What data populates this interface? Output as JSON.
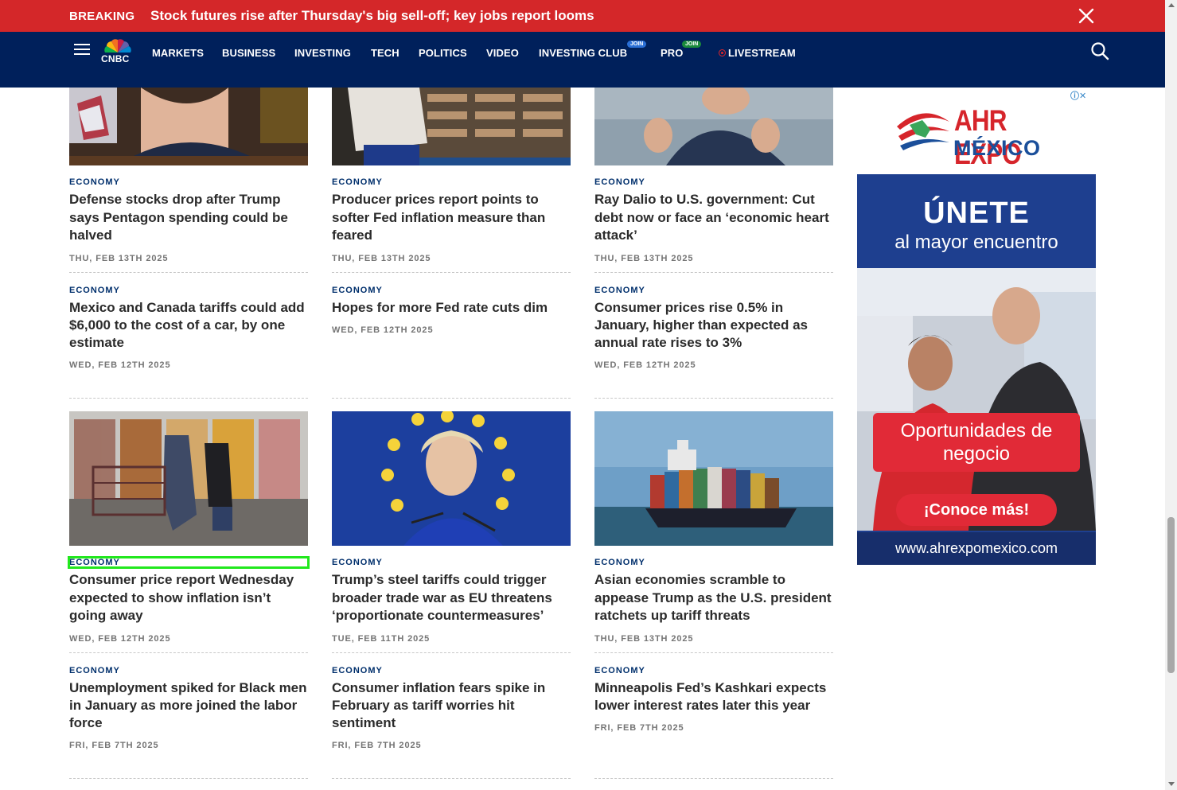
{
  "breaking": {
    "tag": "BREAKING",
    "headline": "Stock futures rise after Thursday's big sell-off; key jobs report looms"
  },
  "nav": {
    "logo_text": "CNBC",
    "links": [
      "MARKETS",
      "BUSINESS",
      "INVESTING",
      "TECH",
      "POLITICS",
      "VIDEO",
      "INVESTING CLUB",
      "PRO",
      "LIVESTREAM"
    ],
    "join_label": "JOIN"
  },
  "articles": [
    {
      "kicker": "ECONOMY",
      "title": "Defense stocks drop after Trump says Pentagon spending could be halved",
      "date": "THU, FEB 13TH 2025"
    },
    {
      "kicker": "ECONOMY",
      "title": "Producer prices report points to softer Fed inflation measure than feared",
      "date": "THU, FEB 13TH 2025"
    },
    {
      "kicker": "ECONOMY",
      "title": "Ray Dalio to U.S. government: Cut debt now or face an ‘economic heart attack’",
      "date": "THU, FEB 13TH 2025"
    },
    {
      "kicker": "ECONOMY",
      "title": "Mexico and Canada tariffs could add $6,000 to the cost of a car, by one estimate",
      "date": "WED, FEB 12TH 2025"
    },
    {
      "kicker": "ECONOMY",
      "title": "Hopes for more Fed rate cuts dim",
      "date": "WED, FEB 12TH 2025"
    },
    {
      "kicker": "ECONOMY",
      "title": "Consumer prices rise 0.5% in January, higher than expected as annual rate rises to 3%",
      "date": "WED, FEB 12TH 2025"
    },
    {
      "kicker": "ECONOMY",
      "title": "Consumer price report Wednesday expected to show inflation isn’t going away",
      "date": "WED, FEB 12TH 2025"
    },
    {
      "kicker": "ECONOMY",
      "title": "Trump’s steel tariffs could trigger broader trade war as EU threatens ‘proportionate countermeasures’",
      "date": "TUE, FEB 11TH 2025"
    },
    {
      "kicker": "ECONOMY",
      "title": "Asian economies scramble to appease Trump as the U.S. president ratchets up tariff threats",
      "date": "THU, FEB 13TH 2025"
    },
    {
      "kicker": "ECONOMY",
      "title": "Unemployment spiked for Black men in January as more joined the labor force",
      "date": "FRI, FEB 7TH 2025"
    },
    {
      "kicker": "ECONOMY",
      "title": "Consumer inflation fears spike in February as tariff worries hit sentiment",
      "date": "FRI, FEB 7TH 2025"
    },
    {
      "kicker": "ECONOMY",
      "title": "Minneapolis Fed’s Kashkari expects lower interest rates later this year",
      "date": "FRI, FEB 7TH 2025"
    }
  ],
  "ad": {
    "brand_line1": "AHR EXPO",
    "brand_line2": "MÉXICO",
    "headline": "ÚNETE",
    "subheadline": "al mayor encuentro",
    "cta1": "Oportunidades de negocio",
    "cta2": "¡Conoce más!",
    "url": "www.ahrexpomexico.com"
  },
  "colors": {
    "breaking_bg": "#d42729",
    "nav_bg": "#00205b",
    "kicker": "#002f6c",
    "focus_outline": "#22e81d"
  }
}
